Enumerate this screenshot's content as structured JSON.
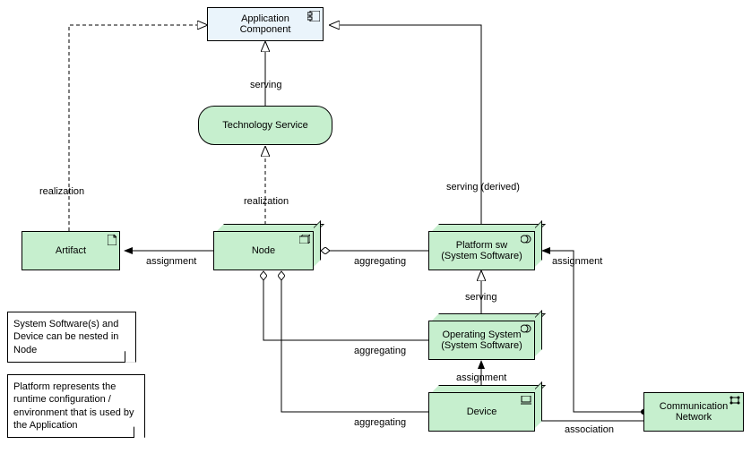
{
  "elements": {
    "app_component": "Application\nComponent",
    "tech_service": "Technology Service",
    "artifact": "Artifact",
    "node": "Node",
    "platform_sw": "Platform sw\n(System Software)",
    "operating_system": "Operating System\n(System Software)",
    "device": "Device",
    "comm_network": "Communication\nNetwork"
  },
  "relations": {
    "serving1": "serving",
    "realization1": "realization",
    "realization2": "realization",
    "serving_derived": "serving (derived)",
    "assignment1": "assignment",
    "assignment2": "assignment",
    "assignment3": "assignment",
    "aggregating1": "aggregating",
    "aggregating2": "aggregating",
    "aggregating3": "aggregating",
    "serving2": "serving",
    "association": "association"
  },
  "notes": {
    "note1": "System Software(s) and Device can be nested in Node",
    "note2": "Platform represents the runtime configuration / environment that is used by the Application"
  }
}
